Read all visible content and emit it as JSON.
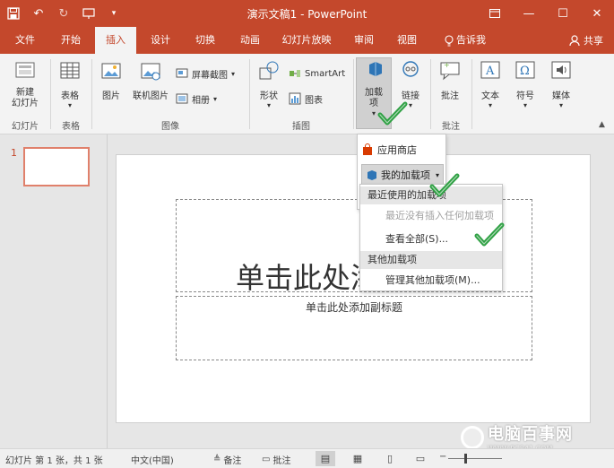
{
  "app": {
    "document_title": "演示文稿1 - PowerPoint",
    "accent_color": "#c4482c"
  },
  "tabs": [
    {
      "label": "文件"
    },
    {
      "label": "开始"
    },
    {
      "label": "插入"
    },
    {
      "label": "设计"
    },
    {
      "label": "切换"
    },
    {
      "label": "动画"
    },
    {
      "label": "幻灯片放映"
    },
    {
      "label": "审阅"
    },
    {
      "label": "视图"
    },
    {
      "label": "告诉我"
    }
  ],
  "share_label": "共享",
  "ribbon": {
    "new_slide": "新建\n幻灯片",
    "table": "表格",
    "picture": "图片",
    "online_picture": "联机图片",
    "screenshot": "屏幕截图",
    "album": "相册",
    "shapes": "形状",
    "smartart": "SmartArt",
    "chart": "图表",
    "addins": "加载项",
    "link": "链接",
    "comment": "批注",
    "text": "文本",
    "symbol": "符号",
    "media": "媒体",
    "groups": {
      "slides": "幻灯片",
      "tables": "表格",
      "images": "图像",
      "illustrations": "插图",
      "comments": "批注"
    }
  },
  "addins_menu": {
    "store": "应用商店",
    "my_addins": "我的加载项",
    "recent_header": "最近使用的加载项",
    "no_recent": "最近没有插入任何加载项",
    "view_all": "查看全部(S)...",
    "other_header": "其他加载项",
    "manage_other": "管理其他加载项(M)..."
  },
  "thumbnail_number": "1",
  "slide": {
    "title_placeholder": "单击此处添加标题",
    "subtitle_placeholder": "单击此处添加副标题"
  },
  "status": {
    "slide_info": "幻灯片 第 1 张，共 1 张",
    "language": "中文(中国)",
    "notes": "备注",
    "comments": "批注"
  },
  "watermark": {
    "name": "电脑百事网",
    "url": "WWW.PC841.COM"
  }
}
